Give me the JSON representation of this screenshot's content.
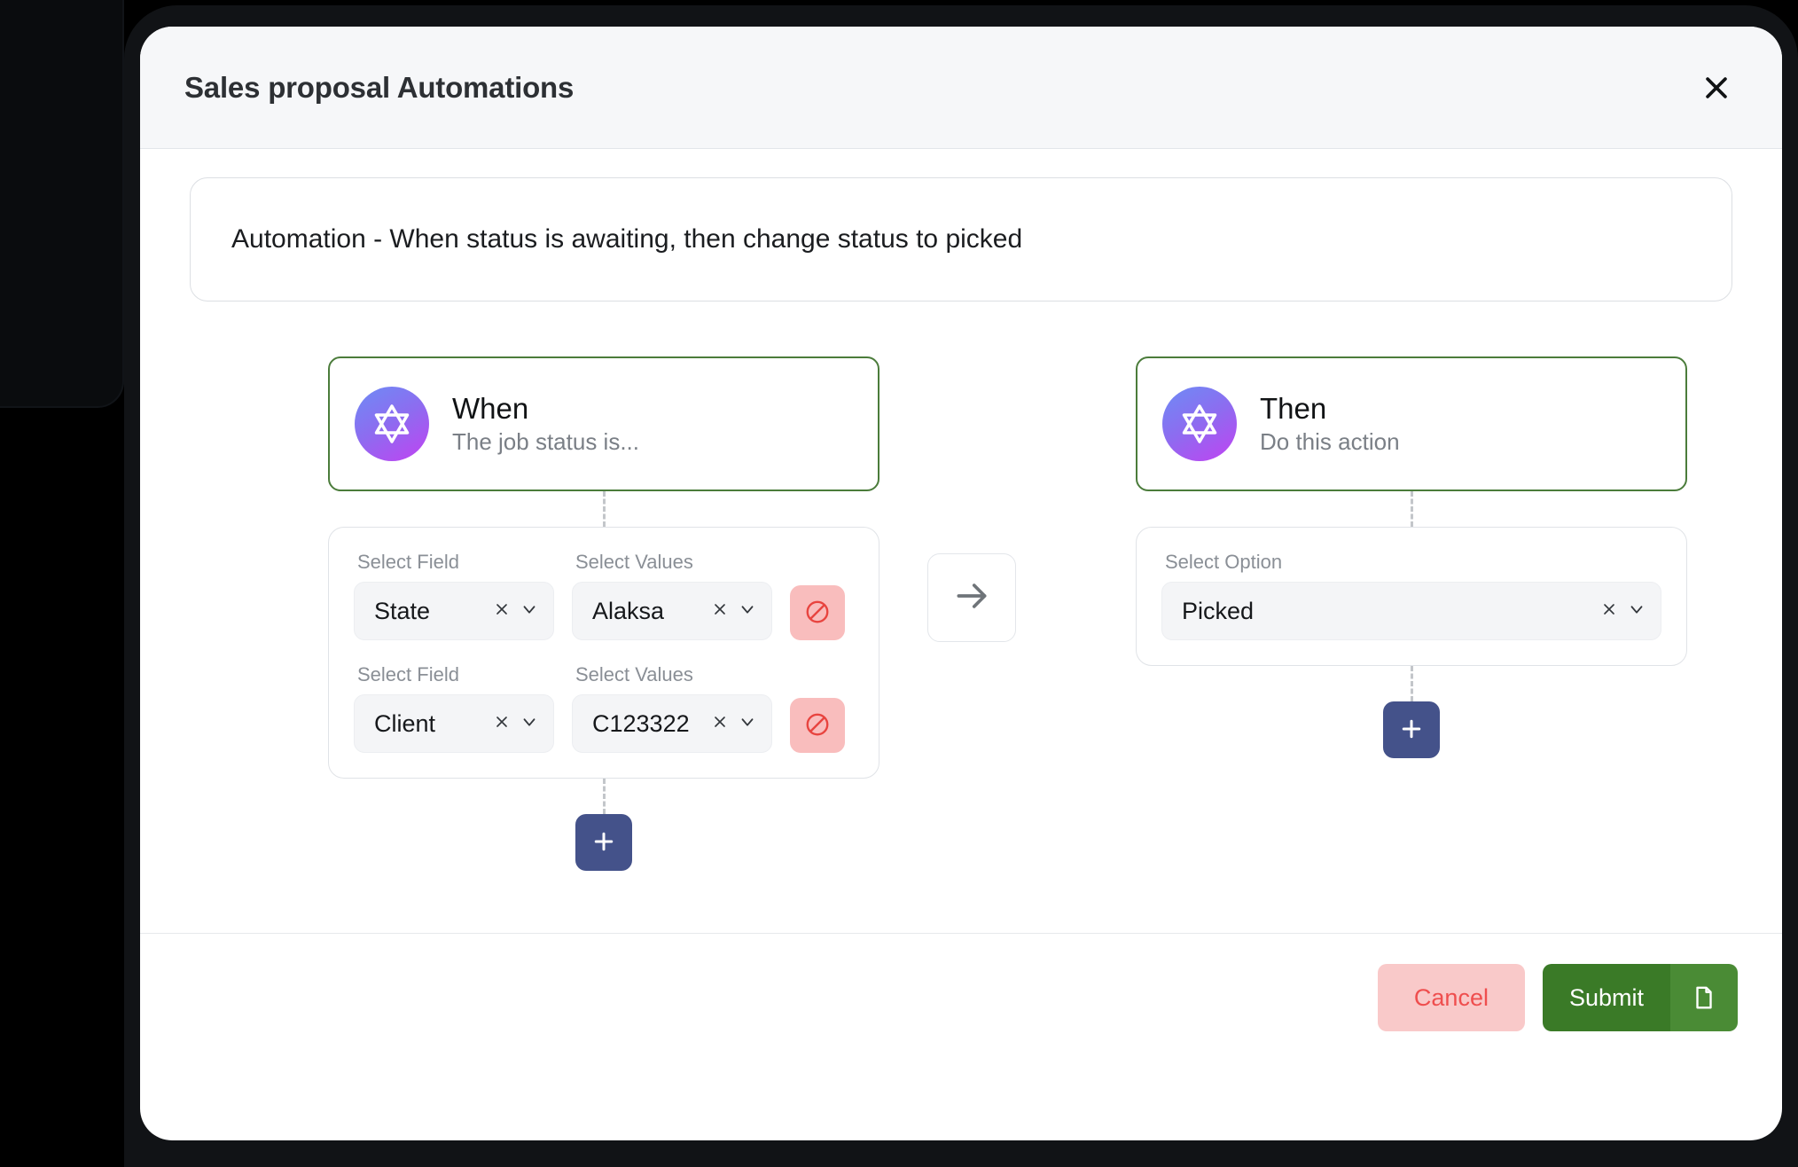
{
  "dialog": {
    "title": "Sales proposal Automations",
    "close_icon": "close-icon"
  },
  "banner": {
    "text": "Automation - When status is awaiting, then change status to picked"
  },
  "flow": {
    "connector_arrow_icon": "arrow-right-icon",
    "when": {
      "card": {
        "icon": "star-of-david-icon",
        "title": "When",
        "subtitle": "The job status is..."
      },
      "conditions": [
        {
          "field_label": "Select Field",
          "field_value": "State",
          "values_label": "Select Values",
          "values_value": "Alaksa",
          "delete_icon": "no-entry-icon"
        },
        {
          "field_label": "Select Field",
          "field_value": "Client",
          "values_label": "Select Values",
          "values_value": "C123322",
          "delete_icon": "no-entry-icon"
        }
      ],
      "add_label": "+"
    },
    "then": {
      "card": {
        "icon": "star-of-david-icon",
        "title": "Then",
        "subtitle": "Do this action"
      },
      "option": {
        "label": "Select Option",
        "value": "Picked"
      },
      "add_label": "+"
    }
  },
  "footer": {
    "cancel_label": "Cancel",
    "submit_label": "Submit",
    "submit_icon": "file-icon"
  },
  "colors": {
    "accent_green": "#3a7a27",
    "card_border_green": "#4b7c3b",
    "add_button_blue": "#44528a",
    "danger_pink": "#f9bdbd",
    "danger_red": "#ef4e4e",
    "header_bg": "#f6f7f9"
  }
}
